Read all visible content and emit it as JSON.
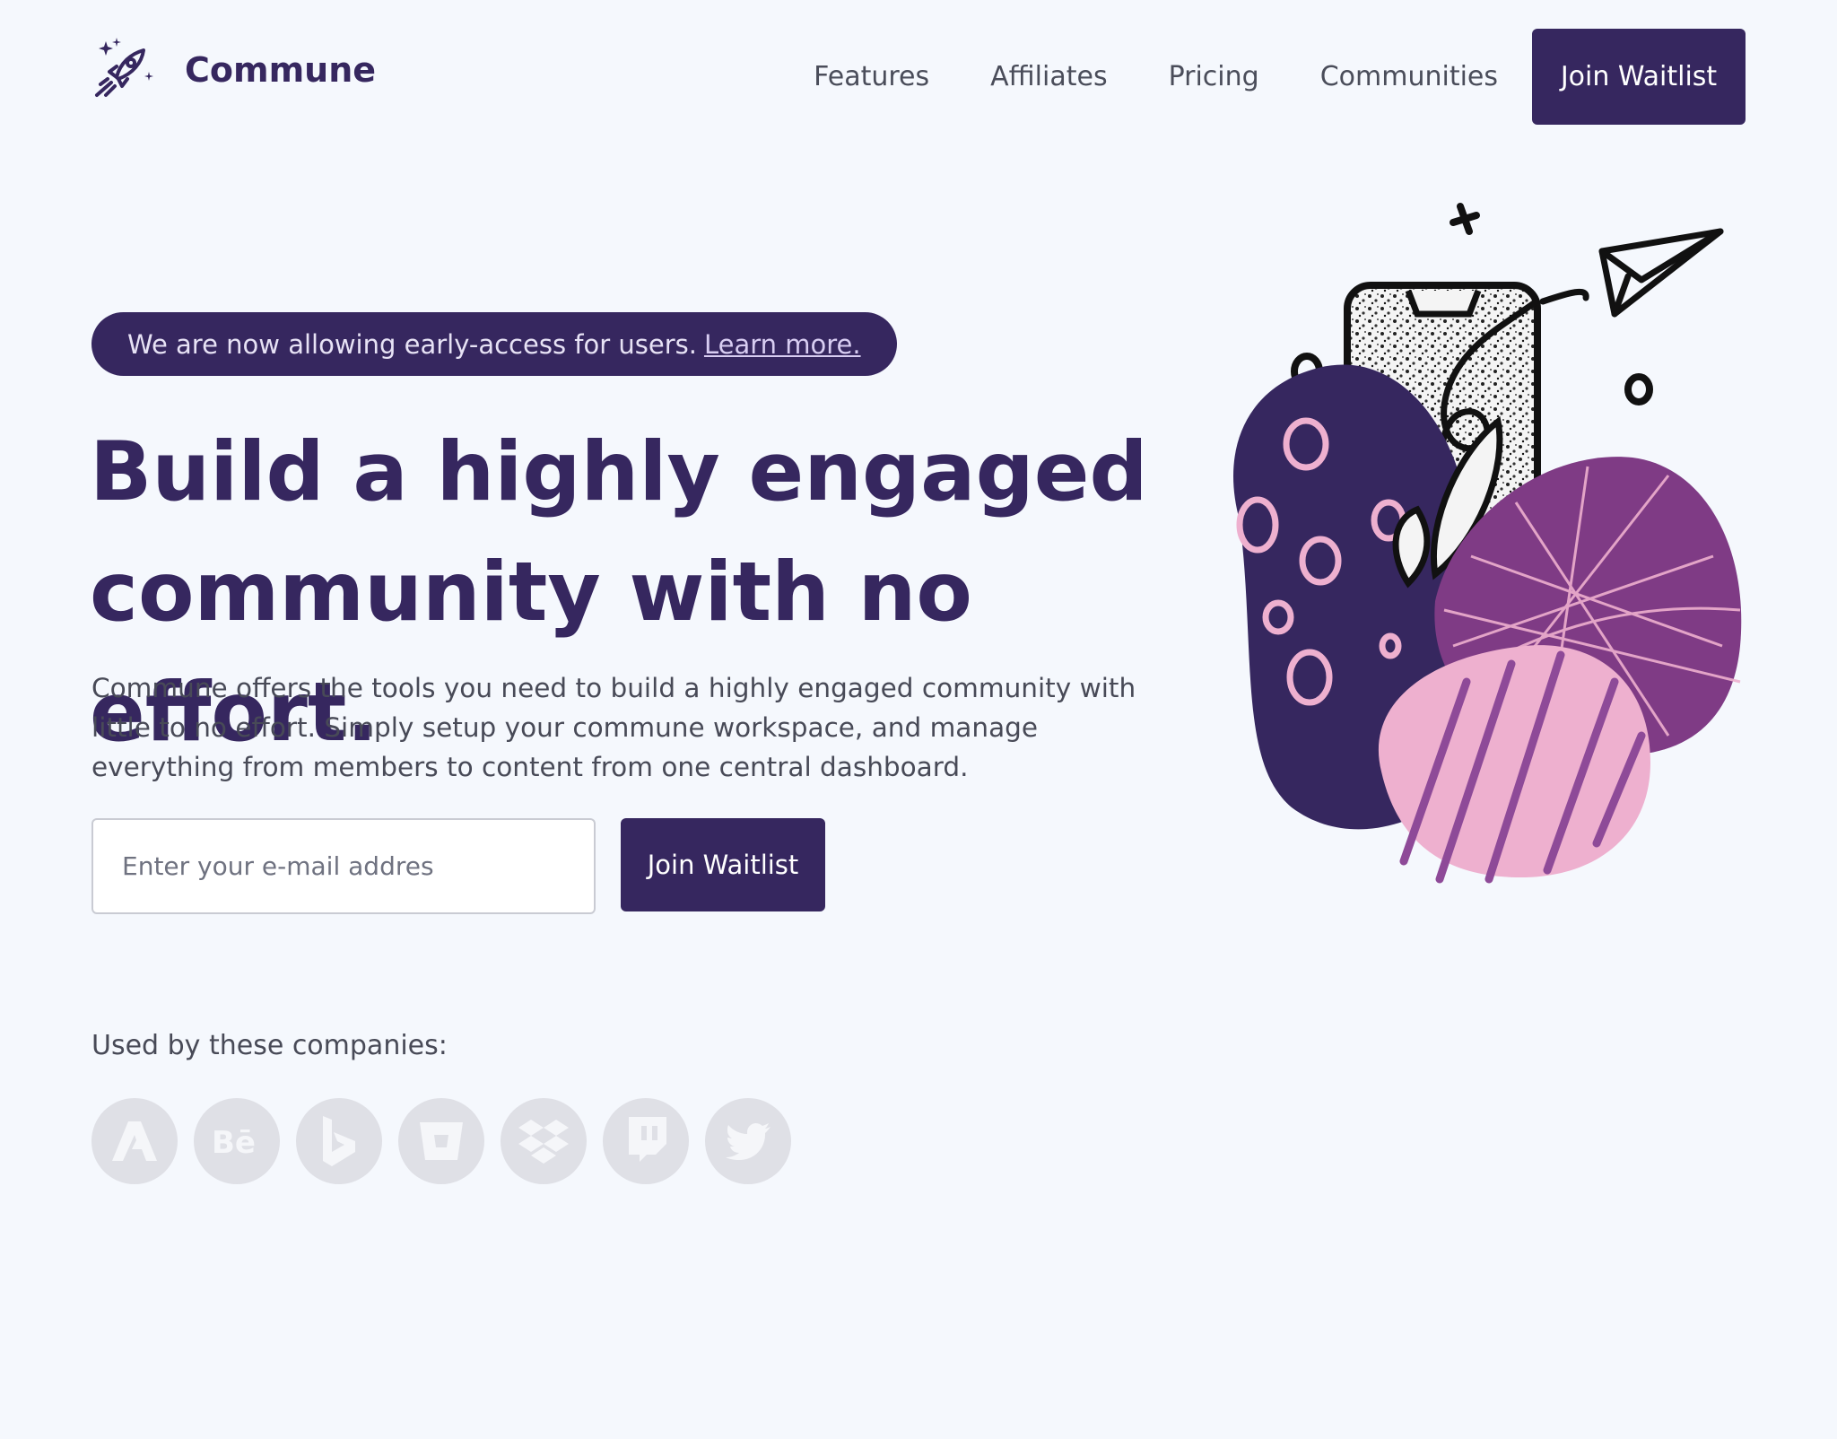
{
  "brand": {
    "name": "Commune",
    "logo_icon": "rocket-icon"
  },
  "nav": {
    "links": [
      "Features",
      "Affiliates",
      "Pricing",
      "Communities"
    ],
    "cta_label": "Join Waitlist"
  },
  "banner": {
    "text": "We are now allowing early-access for users.",
    "link_label": "Learn more."
  },
  "hero": {
    "title": "Build a highly engaged community with no effort.",
    "description": "Commune offers the tools you need to build a highly engaged community with little to no effort. Simply setup your commune workspace, and manage everything from members to content from one central dashboard."
  },
  "signup": {
    "email_placeholder": "Enter your e-mail addres",
    "button_label": "Join Waitlist"
  },
  "companies": {
    "heading": "Used by these companies:",
    "logos": [
      "adobe-icon",
      "behance-icon",
      "bing-icon",
      "bitbucket-icon",
      "dropbox-icon",
      "twitch-icon",
      "twitter-icon"
    ]
  },
  "colors": {
    "primary": "#36275f",
    "background": "#f5f8fd",
    "accent_pink": "#eeb0cf",
    "accent_purple": "#7f3b85"
  }
}
